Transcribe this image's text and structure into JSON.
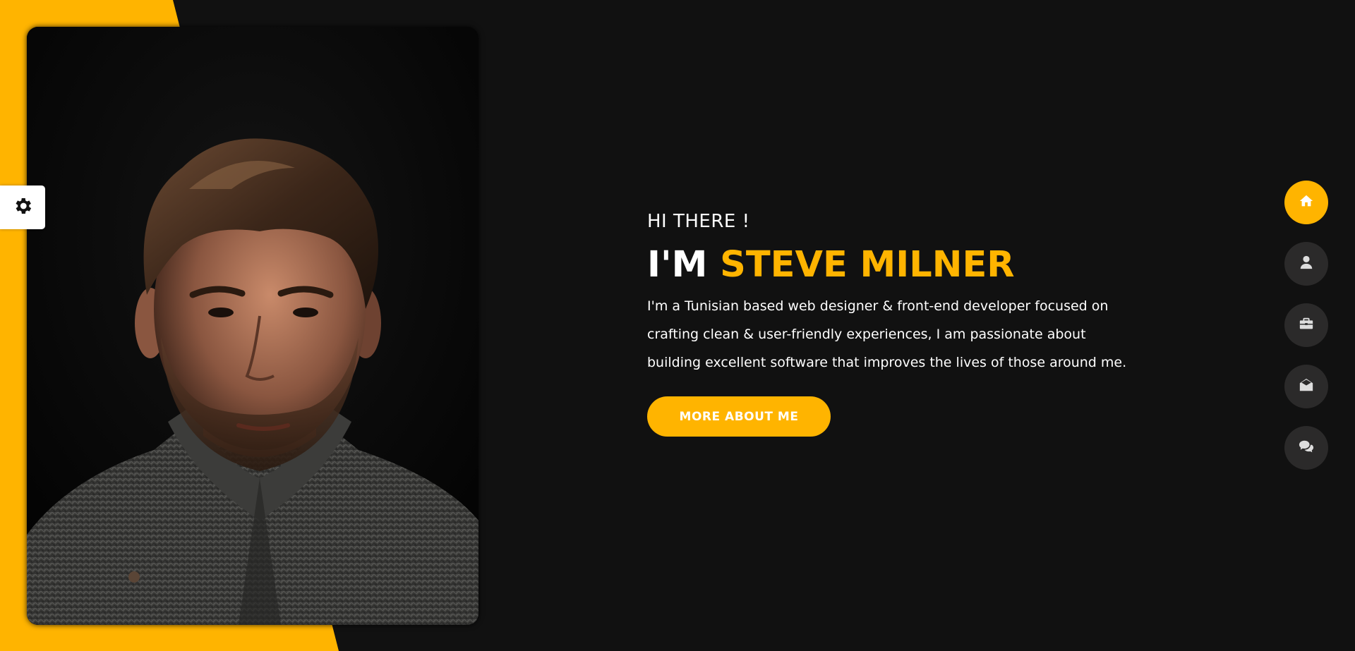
{
  "theme": {
    "accent": "#ffb400",
    "background": "#111111",
    "nav_inactive": "#2b2a2a"
  },
  "settings": {
    "icon": "gear-icon"
  },
  "hero": {
    "greeting": "HI THERE !",
    "name_prefix": "I'M ",
    "name": "STEVE MILNER",
    "bio": "I'm a Tunisian based web designer & front-end developer focused on crafting clean & user-friendly experiences, I am passionate about building excellent software that improves the lives of those around me.",
    "cta_label": "MORE ABOUT ME"
  },
  "portrait": {
    "alt": "portrait-photo"
  },
  "nav": {
    "items": [
      {
        "icon": "home-icon",
        "active": true
      },
      {
        "icon": "user-icon",
        "active": false
      },
      {
        "icon": "briefcase-icon",
        "active": false
      },
      {
        "icon": "envelope-open-icon",
        "active": false
      },
      {
        "icon": "comments-icon",
        "active": false
      }
    ]
  }
}
